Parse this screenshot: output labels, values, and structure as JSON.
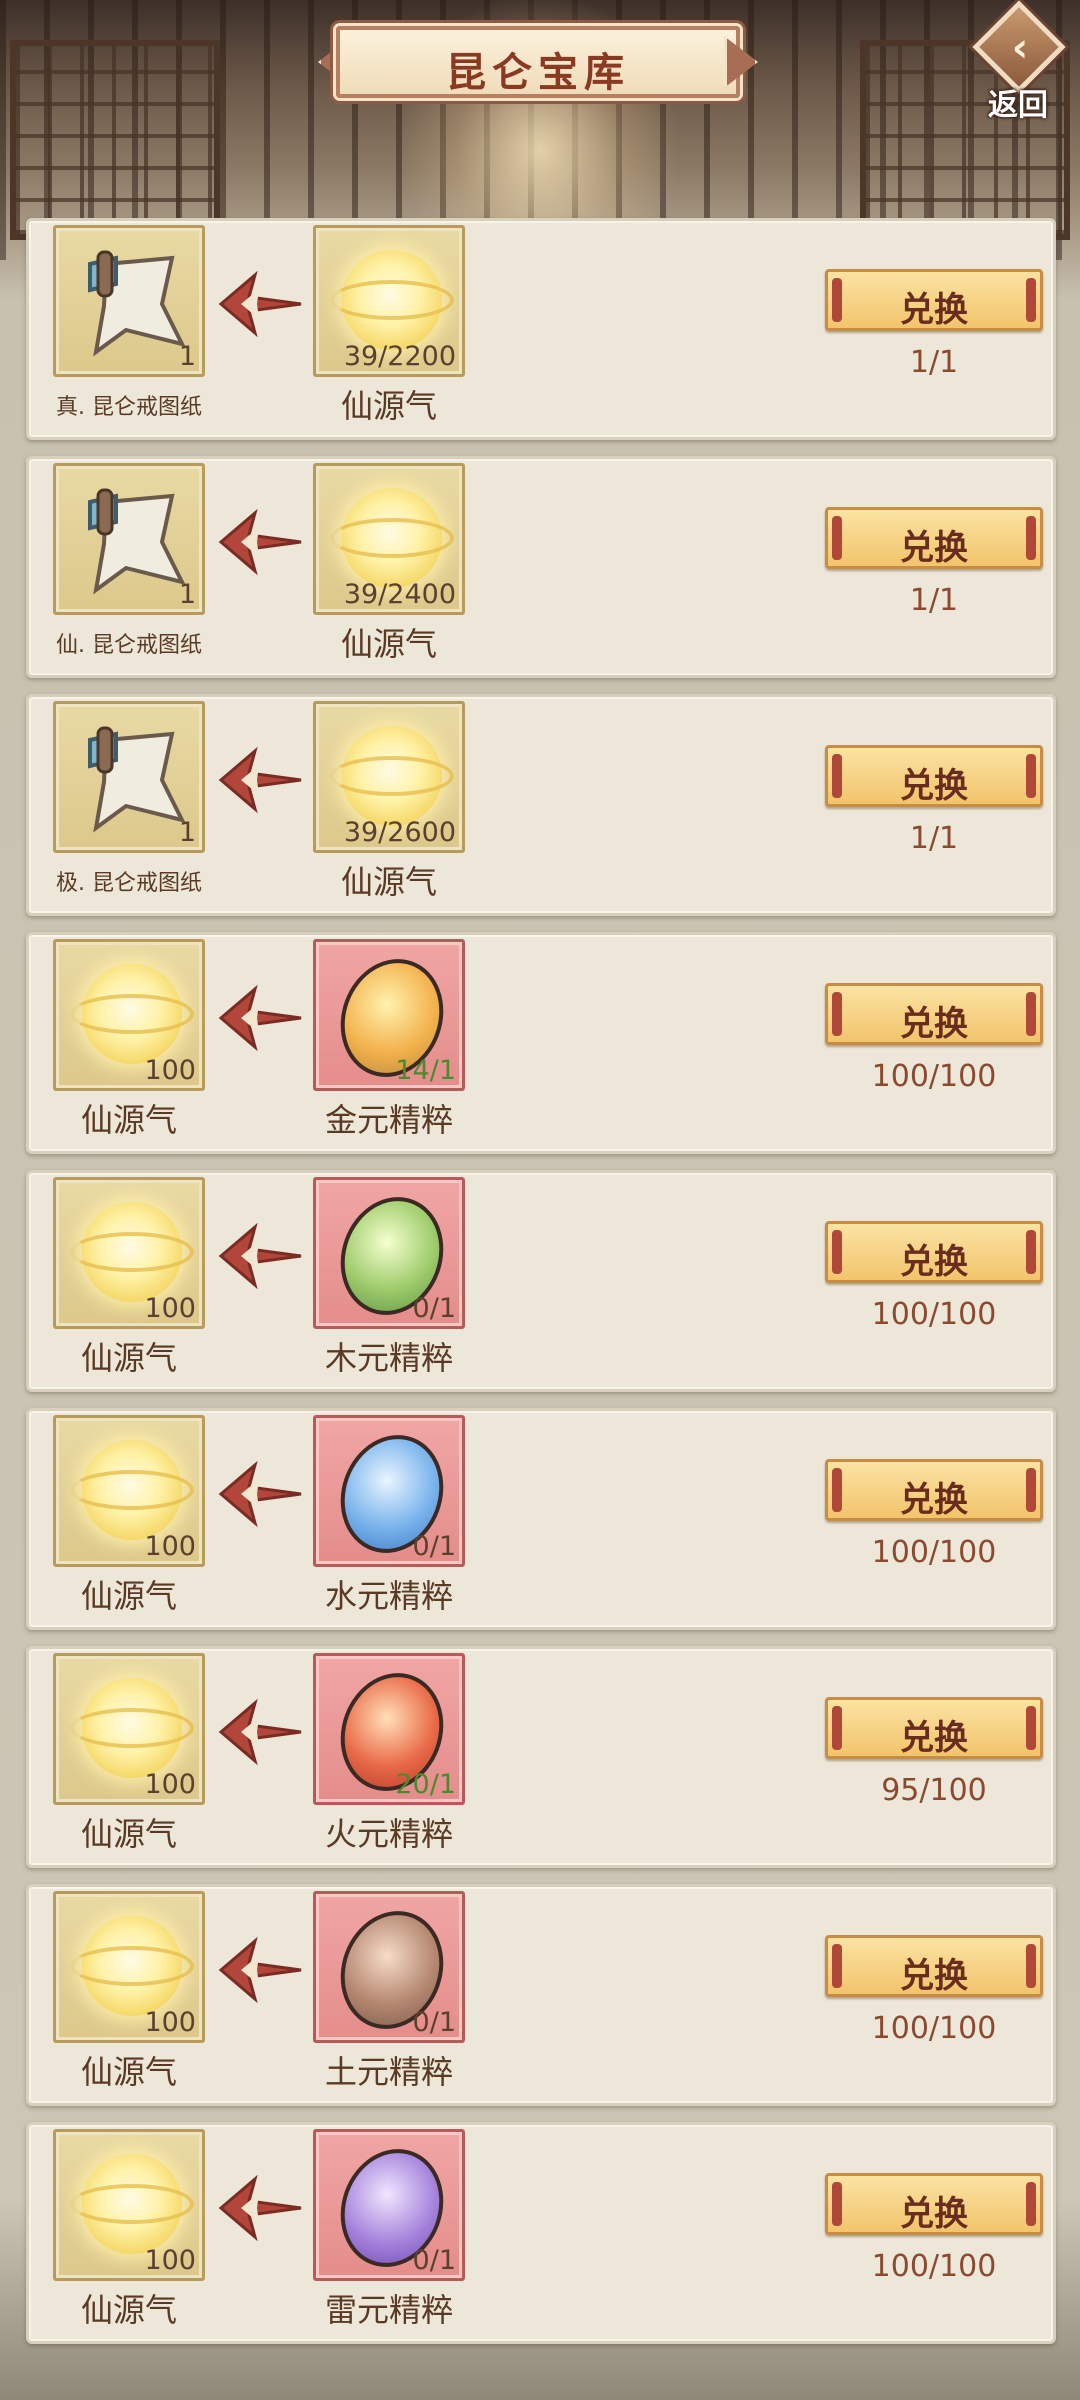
{
  "header": {
    "title": "昆仑宝库",
    "back_label": "返回"
  },
  "exchange_label": "兑换",
  "colors": {
    "panel_bg": "#ece7d8",
    "gold_slot": "#e8d9a4",
    "pink_slot": "#f0a6a4",
    "button": "#f2c46c",
    "title_text": "#8a3a22"
  },
  "rows": [
    {
      "reward": {
        "name": "真. 昆仑戒图纸",
        "count": "1",
        "icon": "scroll-icon"
      },
      "cost": {
        "name": "仙源气",
        "count": "39/2200",
        "icon": "orb-icon"
      },
      "limit": "1/1"
    },
    {
      "reward": {
        "name": "仙. 昆仑戒图纸",
        "count": "1",
        "icon": "scroll-icon"
      },
      "cost": {
        "name": "仙源气",
        "count": "39/2400",
        "icon": "orb-icon"
      },
      "limit": "1/1"
    },
    {
      "reward": {
        "name": "极. 昆仑戒图纸",
        "count": "1",
        "icon": "scroll-icon"
      },
      "cost": {
        "name": "仙源气",
        "count": "39/2600",
        "icon": "orb-icon"
      },
      "limit": "1/1"
    },
    {
      "reward": {
        "name": "仙源气",
        "count": "100",
        "icon": "orb-icon"
      },
      "cost": {
        "name": "金元精粹",
        "count": "14/1",
        "icon": "gold-essence-icon"
      },
      "limit": "100/100"
    },
    {
      "reward": {
        "name": "仙源气",
        "count": "100",
        "icon": "orb-icon"
      },
      "cost": {
        "name": "木元精粹",
        "count": "0/1",
        "icon": "wood-essence-icon"
      },
      "limit": "100/100"
    },
    {
      "reward": {
        "name": "仙源气",
        "count": "100",
        "icon": "orb-icon"
      },
      "cost": {
        "name": "水元精粹",
        "count": "0/1",
        "icon": "water-essence-icon"
      },
      "limit": "100/100"
    },
    {
      "reward": {
        "name": "仙源气",
        "count": "100",
        "icon": "orb-icon"
      },
      "cost": {
        "name": "火元精粹",
        "count": "20/1",
        "icon": "fire-essence-icon"
      },
      "limit": "95/100"
    },
    {
      "reward": {
        "name": "仙源气",
        "count": "100",
        "icon": "orb-icon"
      },
      "cost": {
        "name": "土元精粹",
        "count": "0/1",
        "icon": "earth-essence-icon"
      },
      "limit": "100/100"
    },
    {
      "reward": {
        "name": "仙源气",
        "count": "100",
        "icon": "orb-icon"
      },
      "cost": {
        "name": "雷元精粹",
        "count": "0/1",
        "icon": "thunder-essence-icon"
      },
      "limit": "100/100"
    }
  ]
}
